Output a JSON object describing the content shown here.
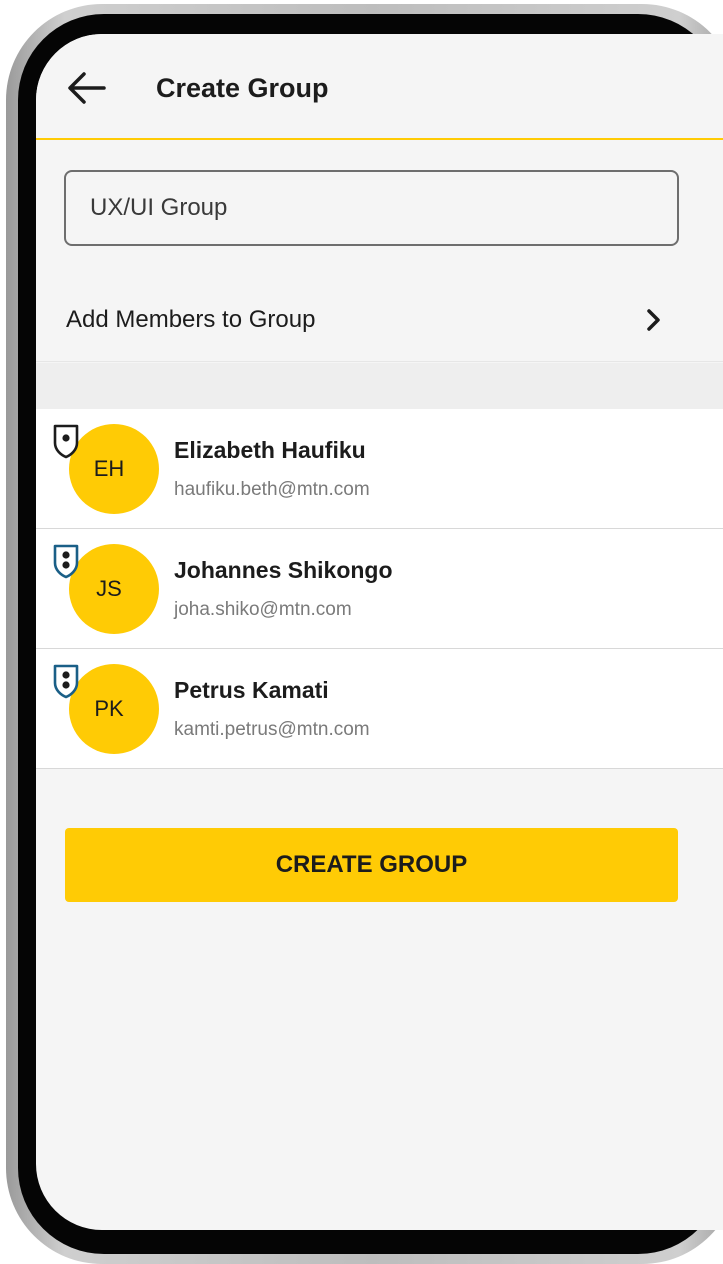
{
  "header": {
    "title": "Create Group",
    "back_icon": "arrow-left-icon"
  },
  "group_name": {
    "value": "UX/UI Group"
  },
  "add_members": {
    "label": "Add Members to Group",
    "icon": "chevron-right-icon"
  },
  "members": [
    {
      "initials": "EH",
      "name": "Elizabeth Haufiku",
      "email": "haufiku.beth@mtn.com",
      "badge": "shield-admin-icon"
    },
    {
      "initials": "JS",
      "name": "Johannes Shikongo",
      "email": "joha.shiko@mtn.com",
      "badge": "shield-member-icon"
    },
    {
      "initials": "PK",
      "name": "Petrus Kamati",
      "email": "kamti.petrus@mtn.com",
      "badge": "shield-member-icon"
    }
  ],
  "actions": {
    "create_label": "CREATE GROUP"
  },
  "colors": {
    "accent": "#ffcb05",
    "badge_admin": "#1c1c1c",
    "badge_member": "#1a5f87",
    "screen_bg": "#f5f5f5"
  }
}
